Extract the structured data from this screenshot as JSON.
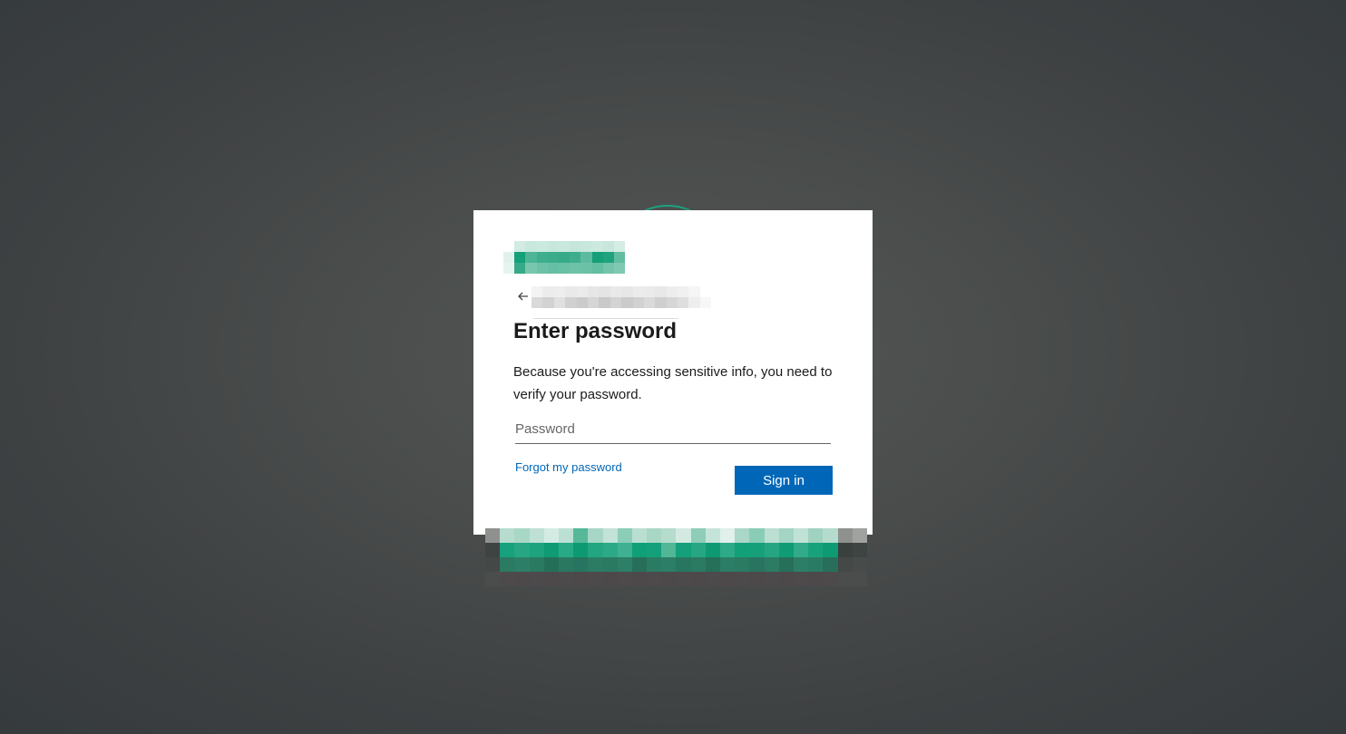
{
  "page": {
    "title": "Enter password",
    "description": "Because you're accessing sensitive info, you need to verify your password.",
    "password_placeholder": "Password",
    "forgot_link": "Forgot my password",
    "signin_label": "Sign in"
  },
  "icons": {
    "back": "arrow-left-icon",
    "logo": "brand-logo"
  },
  "colors": {
    "accent": "#0067b8",
    "brand": "#1aa383",
    "card_bg": "#ffffff",
    "text": "#1b1b1b"
  }
}
